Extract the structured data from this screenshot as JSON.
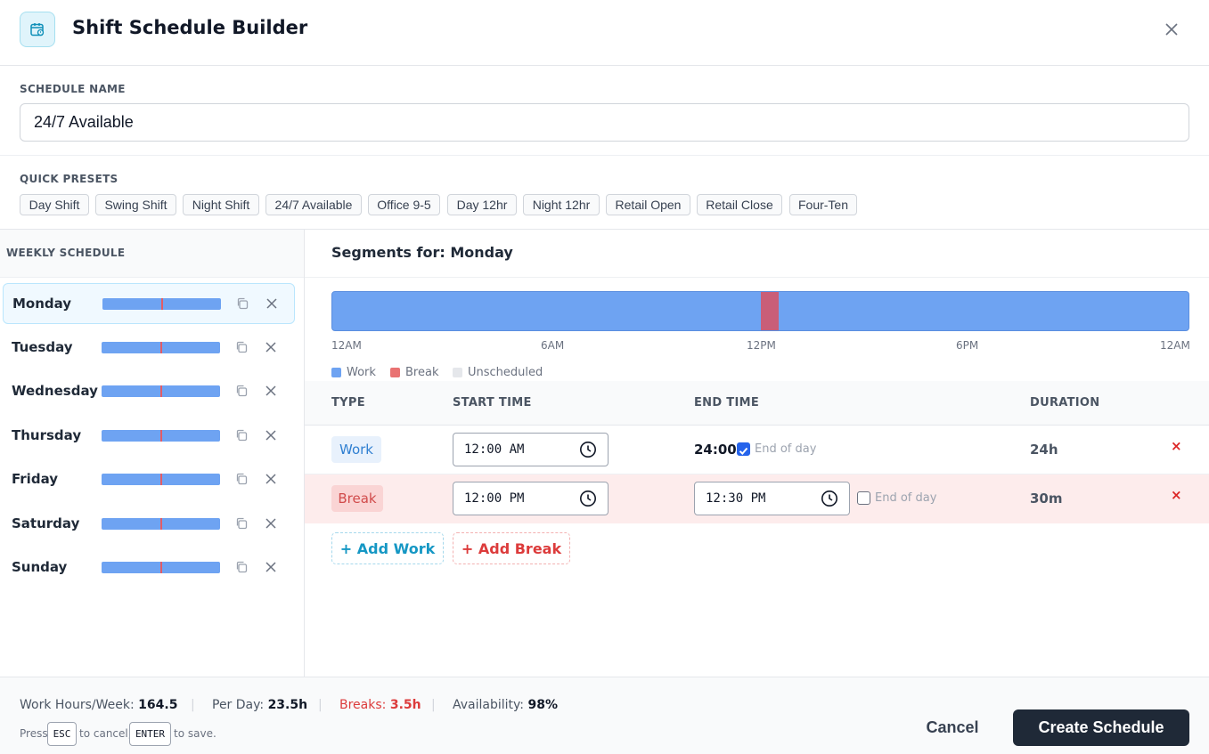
{
  "header": {
    "title": "Shift Schedule Builder",
    "icon": "calendar-clock-icon"
  },
  "schedule_name": {
    "label": "SCHEDULE NAME",
    "value": "24/7 Available"
  },
  "presets": {
    "label": "QUICK PRESETS",
    "items": [
      "Day Shift",
      "Swing Shift",
      "Night Shift",
      "24/7 Available",
      "Office 9-5",
      "Day 12hr",
      "Night 12hr",
      "Retail Open",
      "Retail Close",
      "Four-Ten"
    ]
  },
  "weekly": {
    "label": "WEEKLY SCHEDULE",
    "days": [
      "Monday",
      "Tuesday",
      "Wednesday",
      "Thursday",
      "Friday",
      "Saturday",
      "Sunday"
    ],
    "selected": "Monday",
    "mini_break_fraction": 0.5
  },
  "segments": {
    "title_prefix": "Segments for:",
    "day": "Monday",
    "timeline": {
      "ticks": [
        "12AM",
        "6AM",
        "12PM",
        "6PM",
        "12AM"
      ],
      "work_hours": [
        0,
        24
      ],
      "break_hours": [
        12,
        12.5
      ],
      "colors": {
        "work": "#6ea3f2",
        "break": "#c95e78",
        "unscheduled": "#e5e7eb"
      }
    },
    "legend": [
      {
        "label": "Work",
        "color": "#6ea3f2"
      },
      {
        "label": "Break",
        "color": "#e97272"
      },
      {
        "label": "Unscheduled",
        "color": "#e5e7eb"
      }
    ],
    "columns": [
      "TYPE",
      "START TIME",
      "END TIME",
      "DURATION"
    ],
    "rows": [
      {
        "type": "Work",
        "start": "12:00 AM",
        "end": "24:00",
        "end_of_day": true,
        "end_of_day_label": "End of day",
        "duration": "24h"
      },
      {
        "type": "Break",
        "start": "12:00 PM",
        "end": "12:30 PM",
        "end_of_day": false,
        "end_of_day_label": "End of day",
        "duration": "30m"
      }
    ],
    "remove_symbol": "×",
    "add_work": "+ Add Work",
    "add_break": "+ Add Break"
  },
  "footer": {
    "work_label": "Work Hours/Week:",
    "work_value": "164.5",
    "perday_label": "Per Day:",
    "perday_value": "23.5h",
    "breaks_label": "Breaks:",
    "breaks_value": "3.5h",
    "avail_label": "Availability:",
    "avail_value": "98%",
    "separator": "|",
    "hint_press": "Press",
    "key_esc": "ESC",
    "hint_cancel": "to cancel,",
    "key_enter": "ENTER",
    "hint_save": "to save.",
    "cancel": "Cancel",
    "create": "Create Schedule"
  }
}
